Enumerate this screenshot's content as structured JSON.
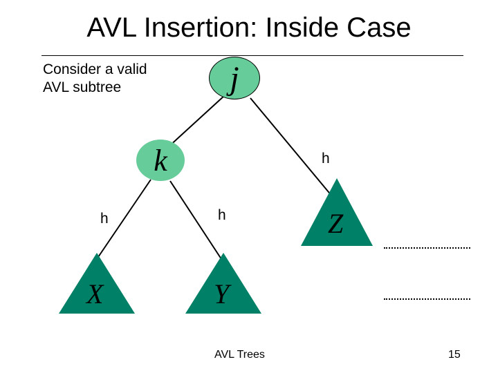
{
  "title": "AVL Insertion: Inside Case",
  "note_line1": "Consider a valid",
  "note_line2": "AVL subtree",
  "nodes": {
    "j": "j",
    "k": "k"
  },
  "triangles": {
    "x": "X",
    "y": "Y",
    "z": "Z"
  },
  "h_labels": {
    "right_of_j": "h",
    "above_x": "h",
    "above_y": "h"
  },
  "footer": "AVL Trees",
  "page_number": "15",
  "colors": {
    "node_fill": "#66cc99",
    "triangle_fill": "#008066"
  }
}
